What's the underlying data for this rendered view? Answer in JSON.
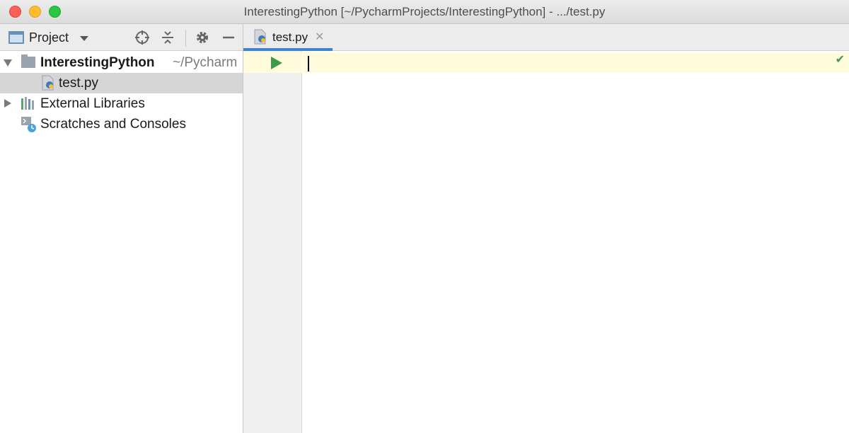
{
  "window": {
    "title": "InterestingPython [~/PycharmProjects/InterestingPython] - .../test.py"
  },
  "sidebar": {
    "toolbar": {
      "view_label": "Project",
      "icons": [
        "locate-icon",
        "collapse-all-icon",
        "gear-icon",
        "minimize-icon"
      ]
    },
    "tree": {
      "project": {
        "name": "InterestingPython",
        "path": "~/Pycharm"
      },
      "file": {
        "name": "test.py"
      },
      "libraries": {
        "name": "External Libraries"
      },
      "scratches": {
        "name": "Scratches and Consoles"
      }
    }
  },
  "editor": {
    "tabs": [
      {
        "label": "test.py",
        "close_glyph": "✕"
      }
    ],
    "inspection_glyph": "✔"
  },
  "colors": {
    "accent": "#4083c9",
    "run": "#3c9b4a",
    "current_line": "#fffbdc"
  }
}
